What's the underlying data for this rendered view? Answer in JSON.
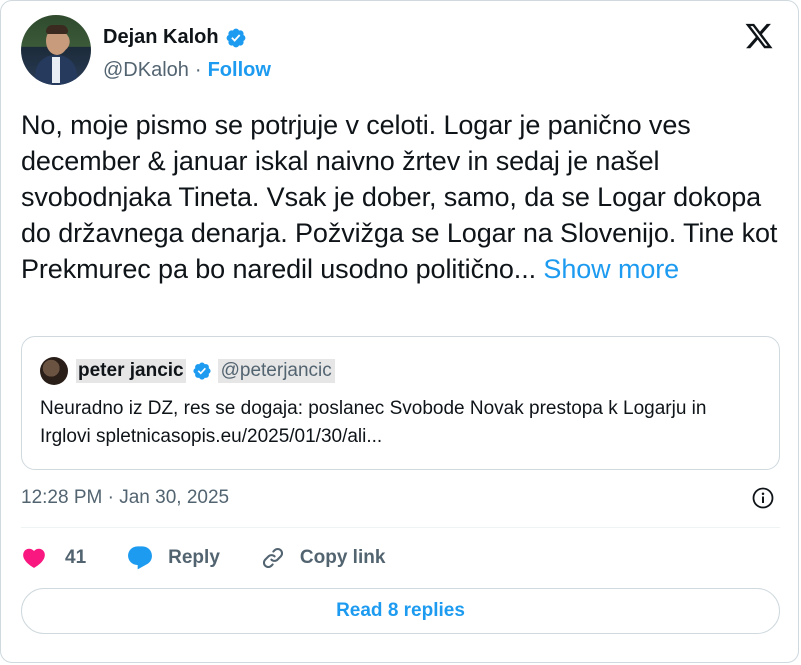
{
  "author": {
    "name": "Dejan Kaloh",
    "handle": "@DKaloh",
    "separator": "·",
    "follow_label": "Follow"
  },
  "tweet": {
    "text": "No, moje pismo se potrjuje v celoti. Logar je panično ves december & januar iskal naivno žrtev in sedaj je našel svobodnjaka Tineta. Vsak je dober, samo, da se Logar dokopa do državnega denarja. Požvižga se Logar na Slovenijo. Tine kot Prekmurec pa bo naredil usodno politično...",
    "show_more": "Show more"
  },
  "quote": {
    "name": "peter jancic",
    "handle": "@peterjancic",
    "text": "Neuradno iz DZ, res se dogaja: poslanec Svobode Novak prestopa k Logarju in Irglovi spletnicasopis.eu/2025/01/30/ali..."
  },
  "timestamp": "12:28 PM · Jan 30, 2025",
  "actions": {
    "like_count": "41",
    "reply_label": "Reply",
    "copy_link_label": "Copy link",
    "read_replies_label": "Read 8 replies"
  },
  "colors": {
    "accent": "#1d9bf0",
    "heart": "#f91880",
    "muted": "#536471",
    "border": "#cfd9de"
  },
  "icons": [
    "verified-badge-icon",
    "x-logo-icon",
    "info-icon",
    "heart-icon",
    "reply-bubble-icon",
    "link-icon"
  ]
}
